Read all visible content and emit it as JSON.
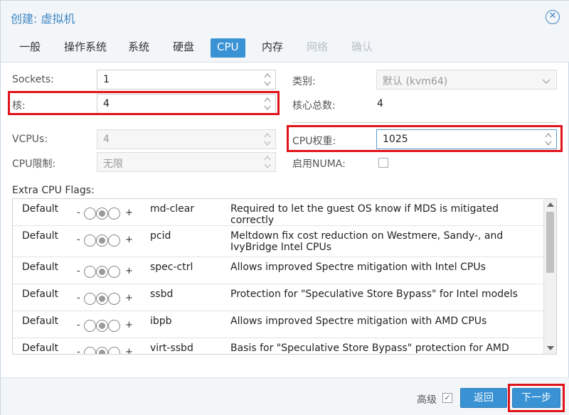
{
  "window": {
    "title": "创建: 虚拟机"
  },
  "tabs": [
    {
      "label": "一般",
      "state": "normal"
    },
    {
      "label": "操作系统",
      "state": "normal"
    },
    {
      "label": "系统",
      "state": "normal"
    },
    {
      "label": "硬盘",
      "state": "normal"
    },
    {
      "label": "CPU",
      "state": "active"
    },
    {
      "label": "内存",
      "state": "normal"
    },
    {
      "label": "网络",
      "state": "disabled"
    },
    {
      "label": "确认",
      "state": "disabled"
    }
  ],
  "form": {
    "sockets_label": "Sockets:",
    "sockets_value": "1",
    "cores_label": "核:",
    "cores_value": "4",
    "type_label": "类别:",
    "type_value": "默认 (kvm64)",
    "total_cores_label": "核心总数:",
    "total_cores_value": "4",
    "vcpus_label": "VCPUs:",
    "vcpus_value": "4",
    "cpu_limit_label": "CPU限制:",
    "cpu_limit_value": "无限",
    "cpu_weight_label": "CPU权重:",
    "cpu_weight_value": "1025",
    "numa_label": "启用NUMA:",
    "numa_checked": false
  },
  "flags": {
    "title": "Extra CPU Flags:",
    "rows": [
      {
        "state": "Default",
        "minus": "-",
        "plus": "+",
        "name": "md-clear",
        "desc": "Required to let the guest OS know if MDS is mitigated correctly"
      },
      {
        "state": "Default",
        "minus": "-",
        "plus": "+",
        "name": "pcid",
        "desc": "Meltdown fix cost reduction on Westmere, Sandy-, and IvyBridge Intel CPUs"
      },
      {
        "state": "Default",
        "minus": "-",
        "plus": "+",
        "name": "spec-ctrl",
        "desc": "Allows improved Spectre mitigation with Intel CPUs"
      },
      {
        "state": "Default",
        "minus": "-",
        "plus": "+",
        "name": "ssbd",
        "desc": "Protection for \"Speculative Store Bypass\" for Intel models"
      },
      {
        "state": "Default",
        "minus": "-",
        "plus": "+",
        "name": "ibpb",
        "desc": "Allows improved Spectre mitigation with AMD CPUs"
      },
      {
        "state": "Default",
        "minus": "-",
        "plus": "+",
        "name": "virt-ssbd",
        "desc": "Basis for \"Speculative Store Bypass\" protection for AMD models"
      }
    ]
  },
  "footer": {
    "advanced_label": "高级",
    "advanced_checked": true,
    "back_label": "返回",
    "next_label": "下一步"
  },
  "colors": {
    "accent": "#3892d4",
    "title_blue": "#3f86c4",
    "highlight_red": "#e0131a"
  },
  "icons": {
    "close": "close-circle-icon",
    "spinner": "spinner-arrows-icon",
    "dropdown": "chevron-down-icon",
    "checkbox": "checkbox-icon"
  }
}
